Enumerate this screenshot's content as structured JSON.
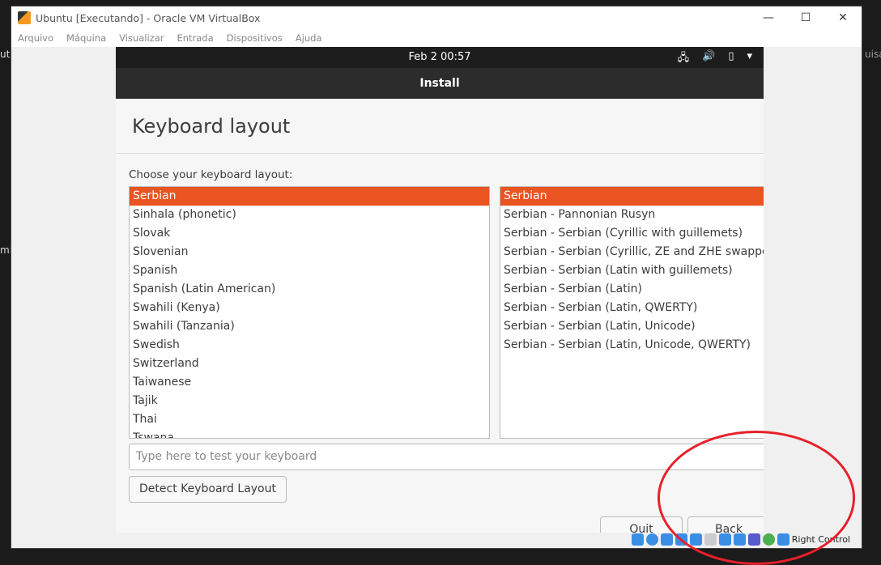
{
  "background_fragments": [
    "uta",
    "mij",
    "uisa"
  ],
  "window": {
    "title": "Ubuntu [Executando] - Oracle VM VirtualBox",
    "controls": [
      "minimize",
      "maximize",
      "close"
    ]
  },
  "menu": [
    "Arquivo",
    "Máquina",
    "Visualizar",
    "Entrada",
    "Dispositivos",
    "Ajuda"
  ],
  "guest": {
    "topbar": {
      "clock": "Feb 2  00:57",
      "tray_icons": [
        "network-icon",
        "volume-icon",
        "battery-icon",
        "menu-arrow-icon"
      ]
    },
    "header": "Install",
    "page_title": "Keyboard layout",
    "prompt": "Choose your keyboard layout:",
    "layouts": [
      "Serbian",
      "Sinhala (phonetic)",
      "Slovak",
      "Slovenian",
      "Spanish",
      "Spanish (Latin American)",
      "Swahili (Kenya)",
      "Swahili (Tanzania)",
      "Swedish",
      "Switzerland",
      "Taiwanese",
      "Tajik",
      "Thai",
      "Tswana"
    ],
    "selected_layout": "Serbian",
    "variants": [
      "Serbian",
      "Serbian - Pannonian Rusyn",
      "Serbian - Serbian (Cyrillic with guillemets)",
      "Serbian - Serbian (Cyrillic, ZE and ZHE swapped)",
      "Serbian - Serbian (Latin with guillemets)",
      "Serbian - Serbian (Latin)",
      "Serbian - Serbian (Latin, QWERTY)",
      "Serbian - Serbian (Latin, Unicode)",
      "Serbian - Serbian (Latin, Unicode, QWERTY)"
    ],
    "selected_variant": "Serbian",
    "test_placeholder": "Type here to test your keyboard",
    "detect_label": "Detect Keyboard Layout",
    "quit_label": "Quit",
    "back_label": "Back",
    "accent": "#e95420"
  },
  "statusbar": {
    "host_key": "Right Control",
    "icons": [
      "hard-disk-icon",
      "optical-drive-icon",
      "audio-icon",
      "network-icon",
      "usb-icon",
      "shared-folders-icon",
      "display-icon",
      "video-capture-icon",
      "vt-x-icon",
      "mouse-integration-icon",
      "keyboard-capture-icon"
    ]
  },
  "annotation_color": "#e8202a"
}
